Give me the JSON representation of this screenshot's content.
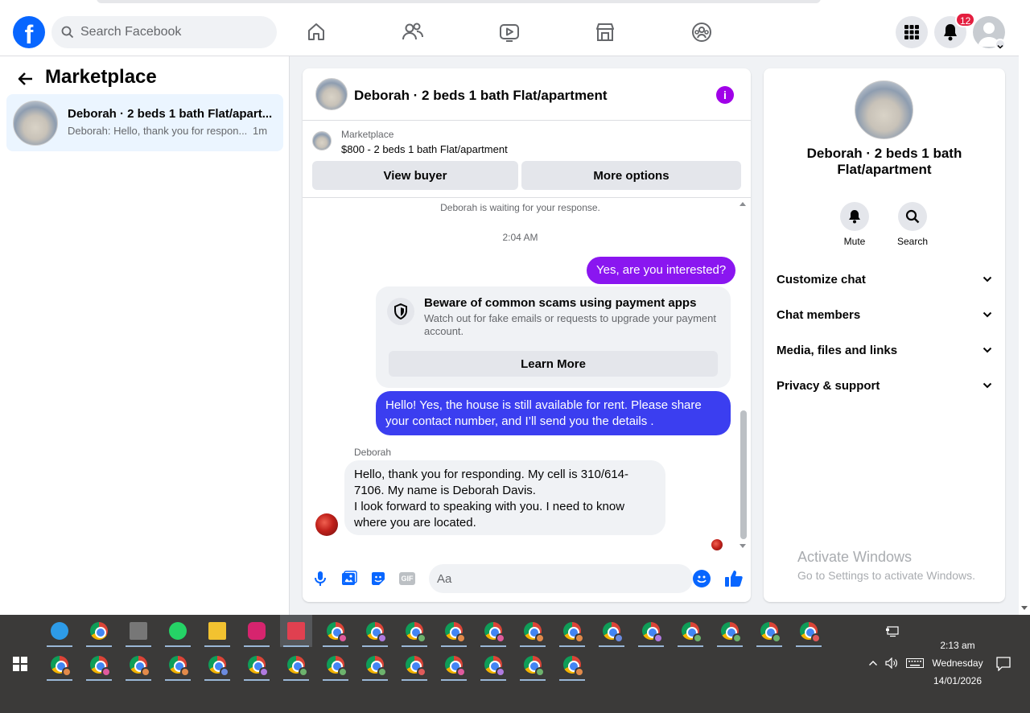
{
  "topnav": {
    "logo": "f",
    "search_placeholder": "Search Facebook",
    "notification_count": "12",
    "icons": [
      "home-icon",
      "friends-icon",
      "video-icon",
      "marketplace-icon",
      "groups-icon",
      "menu-grid-icon",
      "bell-icon",
      "profile-avatar"
    ]
  },
  "left": {
    "title": "Marketplace",
    "conversation": {
      "name": "Deborah · 2 beds 1 bath Flat/apart...",
      "preview": "Deborah: Hello, thank you for respon...",
      "time": "1m"
    }
  },
  "chat": {
    "header_title": "Deborah · 2 beds 1 bath Flat/apartment",
    "marketplace_label": "Marketplace",
    "listing": "$800 - 2 beds 1 bath Flat/apartment",
    "view_buyer": "View buyer",
    "more_options": "More options",
    "waiting": "Deborah is waiting for your response.",
    "time": "2:04 AM",
    "msg_yes": "Yes, are you interested?",
    "scam_title": "Beware of common scams using payment apps",
    "scam_body": "Watch out for fake emails or requests to upgrade your payment account.",
    "learn_more": "Learn More",
    "msg_hello": "Hello! Yes, the house is still available for rent. Please share your contact number, and I’ll send you the details .",
    "sender": "Deborah",
    "msg_deb_line1": "Hello,  thank you for responding. My cell is 310/614-7106.  My name is Deborah Davis.",
    "msg_deb_line2": "I look forward to speaking with you. I need to know where you are located.",
    "composer_placeholder": "Aa",
    "gif_label": "GIF"
  },
  "right": {
    "title": "Deborah · 2 beds 1 bath Flat/apartment",
    "mute": "Mute",
    "search": "Search",
    "rows": [
      "Customize chat",
      "Chat members",
      "Media, files and links",
      "Privacy & support"
    ],
    "activate_title": "Activate Windows",
    "activate_sub": "Go to Settings to activate Windows."
  },
  "taskbar": {
    "time": "2:13 am",
    "day": "Wednesday",
    "date": "14/01/2026"
  },
  "colors": {
    "brand": "#0866ff",
    "sent_purple": "#8a16f0",
    "sent_blue": "#3b3ef0",
    "badge": "#e41e3f"
  }
}
